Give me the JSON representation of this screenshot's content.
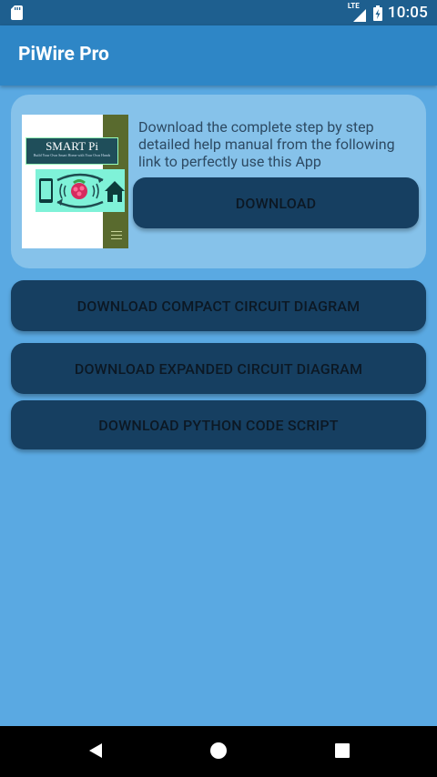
{
  "status_bar": {
    "network": "LTE",
    "time": "10:05"
  },
  "app_bar": {
    "title": "PiWire Pro"
  },
  "manual_card": {
    "cover": {
      "title": "SMART Pi",
      "subtitle": "Build Your Own Smart Home with Your Own Hands"
    },
    "description": "Download the complete step by step detailed help manual from the following link to perfectly use this App",
    "download_label": "DOWNLOAD"
  },
  "actions": {
    "compact_label": "DOWNLOAD COMPACT CIRCUIT DIAGRAM",
    "expanded_label": "DOWNLOAD EXPANDED CIRCUIT DIAGRAM",
    "python_label": "DOWNLOAD PYTHON CODE SCRIPT"
  },
  "icons": {
    "status_left": "sd-card-icon",
    "signal": "signal-icon",
    "battery": "battery-charging-icon",
    "nav_back": "back-icon",
    "nav_home": "home-icon",
    "nav_recents": "recents-icon"
  },
  "colors": {
    "background": "#5aa9e2",
    "app_bar": "#2e86c6",
    "status_bar": "#1e5f8f",
    "card": "#86c2ea",
    "button": "#163f61"
  }
}
